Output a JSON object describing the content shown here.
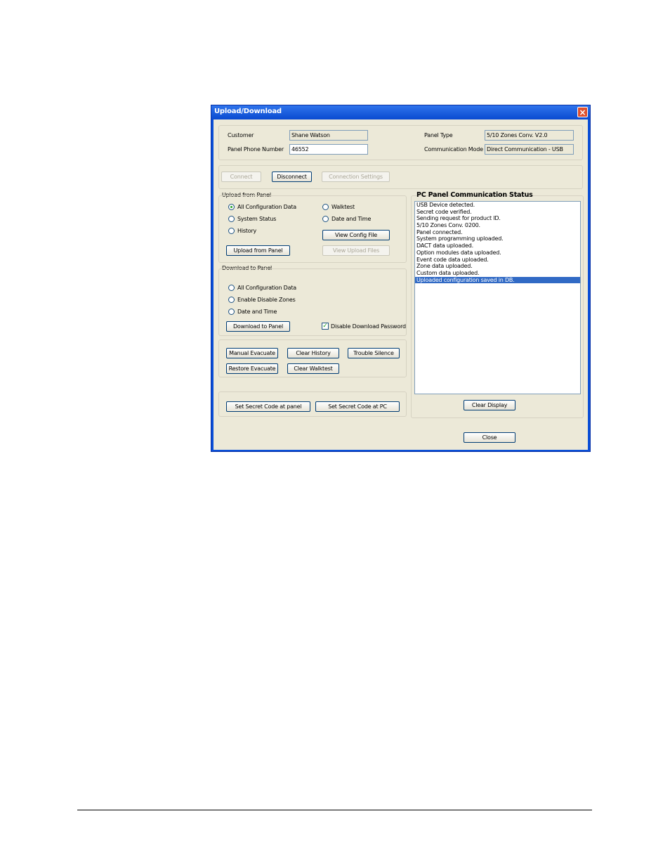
{
  "window": {
    "title": "Upload/Download",
    "close_glyph": "×"
  },
  "customer": {
    "customer_label": "Customer",
    "customer_value": "Shane Watson",
    "phone_label": "Panel Phone Number",
    "phone_value": "46552",
    "panel_type_label": "Panel Type",
    "panel_type_value": "5/10 Zones Conv. V2.0",
    "comm_mode_label": "Communication Mode",
    "comm_mode_value": "Direct Communication - USB"
  },
  "connection": {
    "connect": "Connect",
    "disconnect": "Disconnect",
    "settings": "Connection Settings"
  },
  "upload": {
    "title": "Upload from Panel",
    "options": [
      "All Configuration Data",
      "System Status",
      "History",
      "Walktest",
      "Date and Time"
    ],
    "selected": "All Configuration Data",
    "view_config": "View Config File",
    "view_upload_files": "View Upload Files",
    "upload_button": "Upload from Panel"
  },
  "download": {
    "title": "Download to Panel",
    "options": [
      "All Configuration Data",
      "Enable Disable Zones",
      "Date and Time"
    ],
    "download_button": "Download to Panel",
    "disable_password_label": "Disable Download Password",
    "disable_password_checked": true
  },
  "actions": {
    "manual_evacuate": "Manual Evacuate",
    "clear_history": "Clear History",
    "trouble_silence": "Trouble Silence",
    "restore_evacuate": "Restore Evacuate",
    "clear_walktest": "Clear Walktest"
  },
  "secret": {
    "at_panel": "Set Secret Code at panel",
    "at_pc": "Set Secret Code at PC"
  },
  "status": {
    "title": "PC Panel Communication Status",
    "lines": [
      "USB Device detected.",
      "Secret code verified.",
      "Sending request for product ID.",
      "5/10 Zones Conv. 0200.",
      "Panel connected.",
      "System programming uploaded.",
      "DACT data uploaded.",
      "Option modules data uploaded.",
      "Event code data uploaded.",
      "Zone data uploaded.",
      "Custom data uploaded.",
      "Uploaded configuration saved in DB."
    ],
    "selected_index": 11,
    "clear_display": "Clear Display"
  },
  "close_button": "Close",
  "colors": {
    "title_bar": "#0a4fd8",
    "selection": "#316ac5",
    "dialog_bg": "#ece9d8"
  }
}
